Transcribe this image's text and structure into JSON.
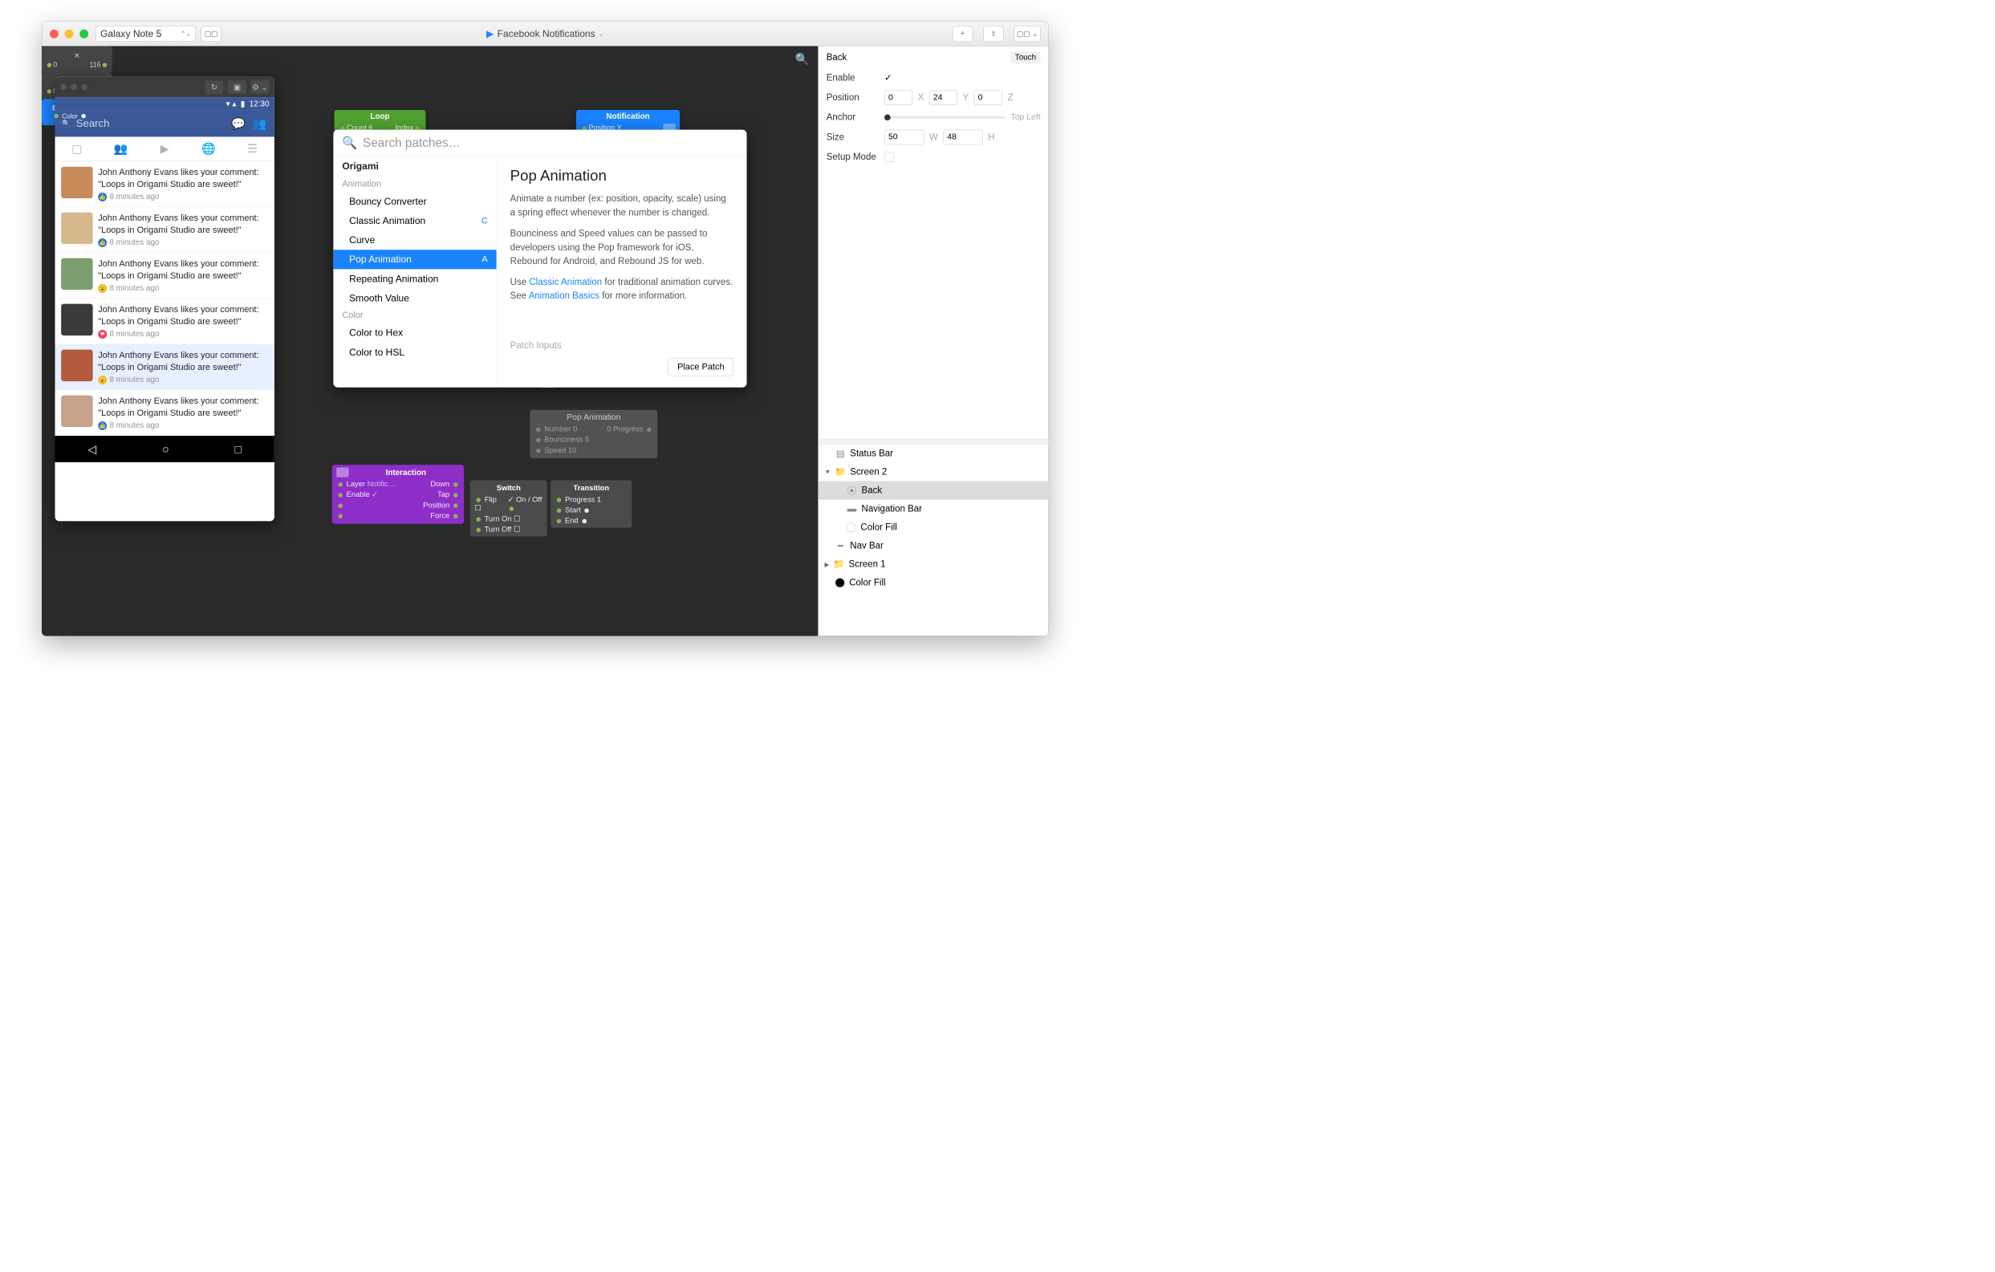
{
  "titlebar": {
    "device": "Galaxy Note 5",
    "doc": "Facebook Notifications"
  },
  "phone": {
    "status_time": "12:30",
    "search_placeholder": "Search",
    "notifications": [
      {
        "text": "John Anthony Evans likes your comment: \"Loops in Origami Studio are sweet!\"",
        "time": "8 minutes ago",
        "reaction": "like",
        "avatarColor": "#c98a5a"
      },
      {
        "text": "John Anthony Evans likes your comment: \"Loops in Origami Studio are sweet!\"",
        "time": "8 minutes ago",
        "reaction": "like",
        "avatarColor": "#d6b88f"
      },
      {
        "text": "John Anthony Evans likes your comment: \"Loops in Origami Studio are sweet!\"",
        "time": "8 minutes ago",
        "reaction": "wow",
        "avatarColor": "#7d9f6f"
      },
      {
        "text": "John Anthony Evans likes your comment: \"Loops in Origami Studio are sweet!\"",
        "time": "8 minutes ago",
        "reaction": "love",
        "avatarColor": "#3a3a3a"
      },
      {
        "text": "John Anthony Evans likes your comment: \"Loops in Origami Studio are sweet!\"",
        "time": "8 minutes ago",
        "reaction": "wow",
        "avatarColor": "#b55a3c",
        "hl": true
      },
      {
        "text": "John Anthony Evans likes your comment: \"Loops in Origami Studio are sweet!\"",
        "time": "8 minutes ago",
        "reaction": "like",
        "avatarColor": "#c7a28a"
      }
    ]
  },
  "patches": {
    "loop": {
      "title": "Loop",
      "count_l": "Count",
      "count_v": "6",
      "index_l": "Index"
    },
    "math": {
      "op": "×",
      "lhs": "0",
      "rhs": "116",
      "rhs2": "116"
    },
    "plus": {
      "op": "+",
      "lhs": "0",
      "rhs": "0"
    },
    "notif": {
      "title": "Notification",
      "posy": "Position Y"
    },
    "pop": {
      "title": "Pop Animation",
      "rows": [
        [
          "Number",
          "0"
        ],
        [
          "Bounciness",
          "5"
        ],
        [
          "Speed",
          "10"
        ]
      ],
      "out": [
        [
          "0",
          "Progress"
        ]
      ]
    },
    "interaction": {
      "title": "Interaction",
      "rows": [
        [
          "Layer",
          "Notific…",
          "Down"
        ],
        [
          "Enable",
          "✓",
          "Tap"
        ],
        [
          "",
          "",
          "Position"
        ],
        [
          "",
          "",
          "Force"
        ]
      ]
    },
    "switch": {
      "title": "Switch",
      "rows": [
        [
          "Flip",
          "☐",
          "On / Off"
        ],
        [
          "Turn On",
          "☐",
          ""
        ],
        [
          "Turn Off",
          "☐",
          ""
        ]
      ]
    },
    "transition": {
      "title": "Transition",
      "rows": [
        [
          "Progress",
          "1"
        ],
        [
          "Start",
          ""
        ],
        [
          "End",
          ""
        ]
      ]
    },
    "bg": {
      "title": "Background",
      "color_l": "Color"
    }
  },
  "popup": {
    "search_placeholder": "Search patches…",
    "sidebar_title": "Origami",
    "group_anim": "Animation",
    "items_anim": [
      {
        "label": "Bouncy Converter",
        "key": ""
      },
      {
        "label": "Classic Animation",
        "key": "C"
      },
      {
        "label": "Curve",
        "key": ""
      },
      {
        "label": "Pop Animation",
        "key": "A",
        "sel": true
      },
      {
        "label": "Repeating Animation",
        "key": ""
      },
      {
        "label": "Smooth Value",
        "key": ""
      }
    ],
    "group_color": "Color",
    "items_color": [
      {
        "label": "Color to Hex",
        "key": ""
      },
      {
        "label": "Color to HSL",
        "key": ""
      }
    ],
    "detail_title": "Pop Animation",
    "detail_p1": "Animate a number (ex: position, opacity, scale) using a spring effect whenever the number is changed.",
    "detail_p2": "Bounciness and Speed values can be passed to developers using the Pop framework for iOS, Rebound for Android, and Rebound JS for web.",
    "detail_p3_a": "Use ",
    "detail_p3_link1": "Classic Animation",
    "detail_p3_b": " for traditional animation curves. See ",
    "detail_p3_link2": "Animation Basics",
    "detail_p3_c": " for more information.",
    "patch_inputs": "Patch Inputs",
    "place_btn": "Place Patch"
  },
  "inspector": {
    "title": "Back",
    "touch": "Touch",
    "enable_l": "Enable",
    "enable_v": "✓",
    "position_l": "Position",
    "px": "0",
    "py": "24",
    "pz": "0",
    "anchor_l": "Anchor",
    "anchor_v": "Top Left",
    "size_l": "Size",
    "sw": "50",
    "sh": "48",
    "setup_l": "Setup Mode",
    "layers": [
      {
        "label": "Status Bar",
        "icon": "status",
        "indent": 0
      },
      {
        "label": "Screen 2",
        "icon": "group",
        "indent": 0,
        "disc": "▼"
      },
      {
        "label": "Back",
        "icon": "back",
        "indent": 1,
        "sel": true
      },
      {
        "label": "Navigation Bar",
        "icon": "navbar",
        "indent": 1
      },
      {
        "label": "Color Fill",
        "icon": "fill",
        "indent": 1,
        "color": "#ffffff"
      },
      {
        "label": "Nav Bar",
        "icon": "navline",
        "indent": 0
      },
      {
        "label": "Screen 1",
        "icon": "group",
        "indent": 0,
        "disc": "▶"
      },
      {
        "label": "Color Fill",
        "icon": "fill",
        "indent": 0,
        "color": "#000000"
      }
    ]
  }
}
